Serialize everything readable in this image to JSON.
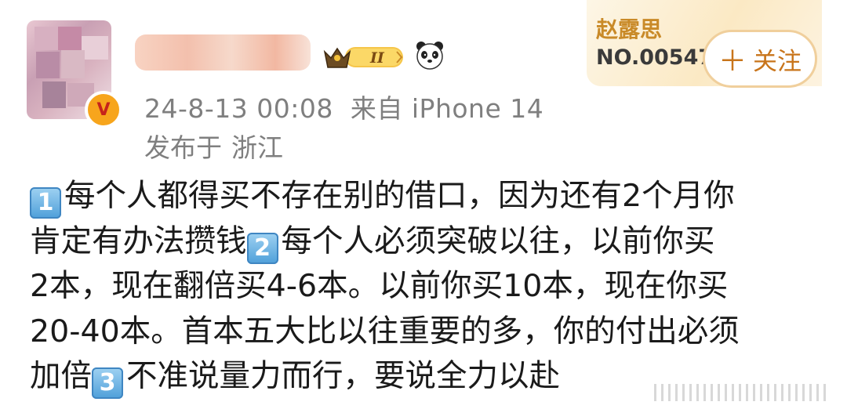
{
  "post": {
    "date": "24-8-13 00:08",
    "source": "来自 iPhone 14",
    "published_prefix": "发布于",
    "location": "浙江",
    "lines": [
      {
        "badge": "1",
        "text": "每个人都得买不存在别的借口，因为还有2个月你"
      },
      {
        "badge": "",
        "text": "肯定有办法攒钱",
        "badge2": "2",
        "text2": "每个人必须突破以往，以前你买"
      },
      {
        "badge": "",
        "text": "2本，现在翻倍买4-6本。以前你买10本，现在你买"
      },
      {
        "badge": "",
        "text": "20-40本。首本五大比以往重要的多，你的付出必须"
      },
      {
        "badge": "",
        "text": "加倍",
        "badge2": "3",
        "text2": "不准说量力而行，要说全力以赴"
      }
    ]
  },
  "fan_card": {
    "name": "赵露思",
    "number": "NO.005479"
  },
  "follow_button": {
    "label": "关注",
    "icon": "plus-icon"
  },
  "user": {
    "verified_badge": "V",
    "level_badge": "II",
    "emoji": "panda-icon"
  },
  "colors": {
    "meta_gray": "#7f7f7f",
    "follow_orange": "#c8741a",
    "fan_gold": "#c98a28",
    "keycap_blue": "#4e9fd9"
  }
}
